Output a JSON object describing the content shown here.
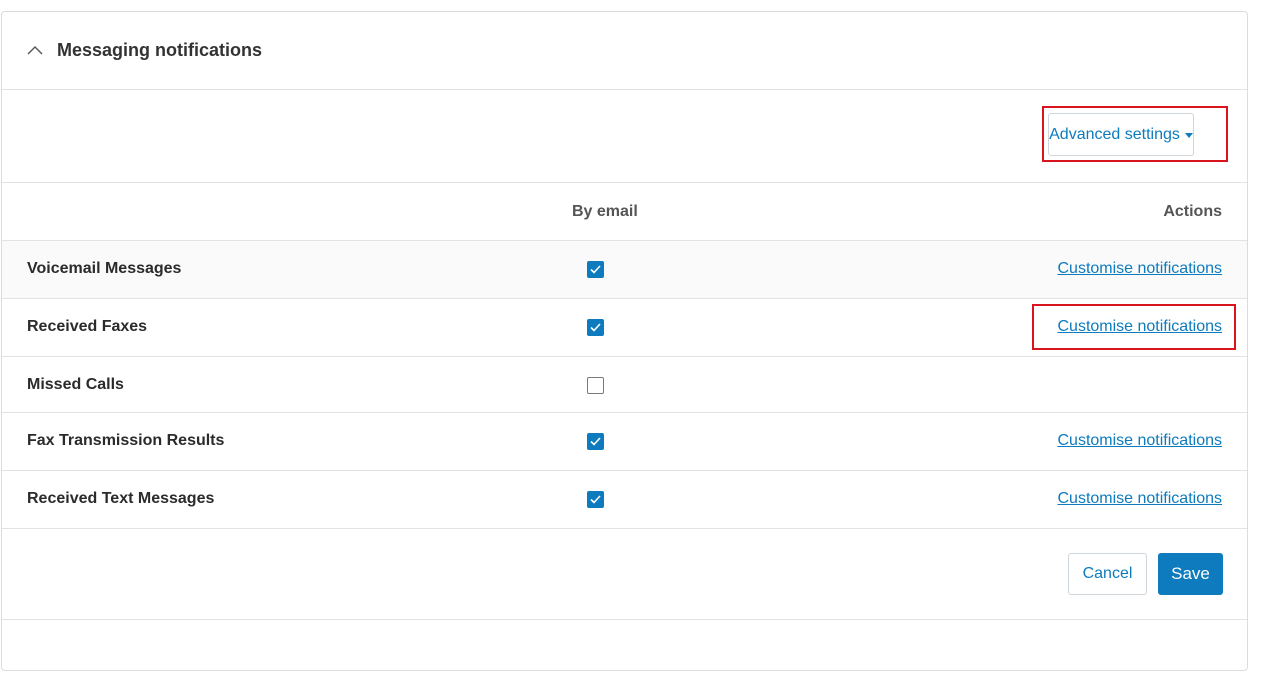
{
  "section": {
    "title": "Messaging notifications",
    "toggle_icon": "chevron-up-icon"
  },
  "toolbar": {
    "advanced_label": "Advanced settings",
    "advanced_icon": "caret-down-icon"
  },
  "table": {
    "headers": {
      "by_email": "By email",
      "actions": "Actions"
    },
    "rows": [
      {
        "label": "Voicemail Messages",
        "by_email": true,
        "action": "Customise notifications"
      },
      {
        "label": "Received Faxes",
        "by_email": true,
        "action": "Customise notifications"
      },
      {
        "label": "Missed Calls",
        "by_email": false,
        "action": ""
      },
      {
        "label": "Fax Transmission Results",
        "by_email": true,
        "action": "Customise notifications"
      },
      {
        "label": "Received Text Messages",
        "by_email": true,
        "action": "Customise notifications"
      }
    ]
  },
  "footer": {
    "cancel_label": "Cancel",
    "save_label": "Save"
  },
  "colors": {
    "accent": "#0d7bbd",
    "highlight": "#d9141c",
    "border": "#e3e3e3"
  }
}
